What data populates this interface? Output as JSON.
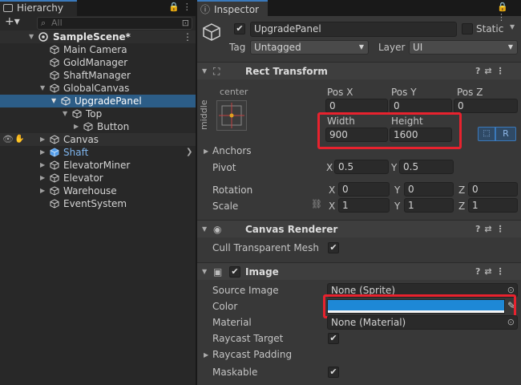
{
  "hierarchy": {
    "tab_label": "Hierarchy",
    "search_placeholder": "All",
    "scene": "SampleScene*",
    "items": [
      {
        "label": "Main Camera"
      },
      {
        "label": "GoldManager"
      },
      {
        "label": "ShaftManager"
      },
      {
        "label": "GlobalCanvas"
      },
      {
        "label": "UpgradePanel"
      },
      {
        "label": "Top"
      },
      {
        "label": "Button"
      },
      {
        "label": "Canvas"
      },
      {
        "label": "Shaft"
      },
      {
        "label": "ElevatorMiner"
      },
      {
        "label": "Elevator"
      },
      {
        "label": "Warehouse"
      },
      {
        "label": "EventSystem"
      }
    ]
  },
  "inspector": {
    "tab_label": "Inspector",
    "object_name": "UpgradePanel",
    "static_label": "Static",
    "tag_label": "Tag",
    "tag_value": "Untagged",
    "layer_label": "Layer",
    "layer_value": "UI"
  },
  "rect_transform": {
    "title": "Rect Transform",
    "anchor_h": "center",
    "anchor_v": "middle",
    "pos_x_label": "Pos X",
    "pos_y_label": "Pos Y",
    "pos_z_label": "Pos Z",
    "pos_x": "0",
    "pos_y": "0",
    "pos_z": "0",
    "width_label": "Width",
    "height_label": "Height",
    "width": "900",
    "height": "1600",
    "r_button": "R",
    "anchors_label": "Anchors",
    "pivot_label": "Pivot",
    "pivot_x": "0.5",
    "pivot_y": "0.5",
    "rotation_label": "Rotation",
    "rot_x": "0",
    "rot_y": "0",
    "rot_z": "0",
    "scale_label": "Scale",
    "scale_x": "1",
    "scale_y": "1",
    "scale_z": "1",
    "x": "X",
    "y": "Y",
    "z": "Z"
  },
  "canvas_renderer": {
    "title": "Canvas Renderer",
    "cull_label": "Cull Transparent Mesh"
  },
  "image": {
    "title": "Image",
    "source_label": "Source Image",
    "source_value": "None (Sprite)",
    "color_label": "Color",
    "color_value": "#1e88d6",
    "material_label": "Material",
    "material_value": "None (Material)",
    "raycast_target_label": "Raycast Target",
    "raycast_padding_label": "Raycast Padding",
    "maskable_label": "Maskable"
  },
  "colors": {
    "selection": "#2c5d87",
    "highlight": "#e8222e",
    "prefab_blue": "#7fb6ef"
  }
}
